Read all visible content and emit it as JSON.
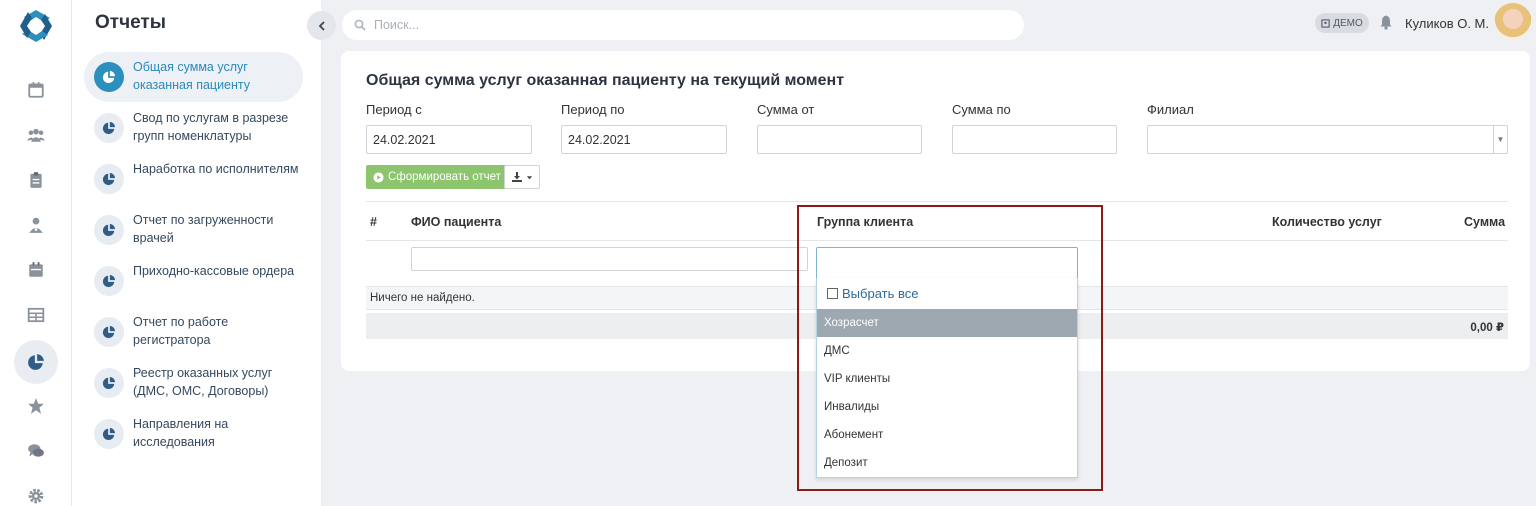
{
  "panel": {
    "title": "Отчеты",
    "reports": [
      {
        "label": "Общая сумма услуг оказанная пациенту",
        "active": true
      },
      {
        "label": "Свод по услугам в разрезе групп номенклатуры"
      },
      {
        "label": "Наработка по исполнителям"
      },
      {
        "label": "Отчет по загруженности врачей"
      },
      {
        "label": "Приходно-кассовые ордера"
      },
      {
        "label": "Отчет по работе регистратора"
      },
      {
        "label": "Реестр оказанных услуг (ДМС, ОМС, Договоры)"
      },
      {
        "label": "Направления на исследования"
      }
    ]
  },
  "rail": {
    "icons": [
      "calendar-icon",
      "users-icon",
      "clipboard-icon",
      "doctor-icon",
      "schedule-icon",
      "table-icon",
      "pie-chart-icon",
      "star-icon",
      "chat-icon",
      "gear-icon"
    ],
    "active": "pie-chart-icon"
  },
  "topbar": {
    "search_placeholder": "Поиск...",
    "demo_badge": "ДЕМО",
    "user_name": "Куликов О. М."
  },
  "report": {
    "title": "Общая сумма услуг оказанная пациенту на текущий момент",
    "filters": {
      "period_from_label": "Период с",
      "period_from_value": "24.02.2021",
      "period_to_label": "Период по",
      "period_to_value": "24.02.2021",
      "sum_from_label": "Сумма от",
      "sum_from_value": "",
      "sum_to_label": "Сумма по",
      "sum_to_value": "",
      "branch_label": "Филиал",
      "branch_value": ""
    },
    "generate_button": "Сформировать отчет",
    "table": {
      "columns": [
        "#",
        "ФИО пациента",
        "Группа клиента",
        "Количество услуг",
        "Сумма"
      ],
      "empty_text": "Ничего не найдено.",
      "total": "0,00 ₽"
    }
  },
  "dropdown": {
    "search_value": "",
    "select_all": "Выбрать все",
    "options": [
      "Хозрасчет",
      "ДМС",
      "VIP клиенты",
      "Инвалиды",
      "Абонемент",
      "Депозит"
    ],
    "highlighted": "Хозрасчет"
  },
  "colors": {
    "accent": "#2d8fbd",
    "generate_button": "#8cc56d",
    "highlight_border": "#8b1a1a",
    "selected_option": "#9ea8b1"
  }
}
